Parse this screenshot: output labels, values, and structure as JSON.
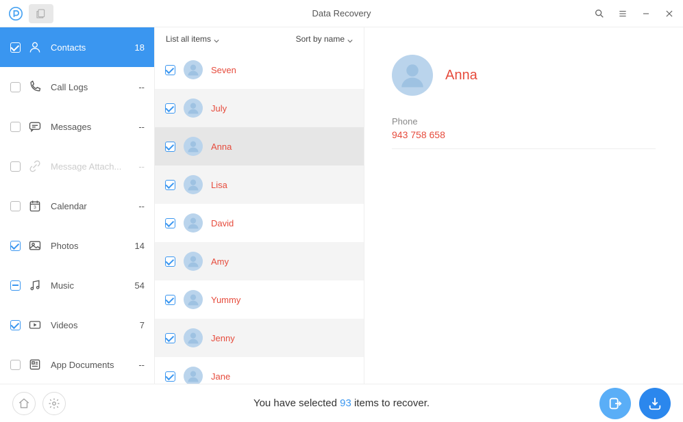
{
  "title": "Data Recovery",
  "dropdowns": {
    "list_mode": "List all items",
    "sort_mode": "Sort by name"
  },
  "sidebar": {
    "items": [
      {
        "id": "contacts",
        "label": "Contacts",
        "count": "18",
        "checked": true,
        "icon": "person-icon",
        "active": true,
        "disabled": false
      },
      {
        "id": "calllogs",
        "label": "Call Logs",
        "count": "--",
        "checked": false,
        "icon": "phone-icon",
        "active": false,
        "disabled": false
      },
      {
        "id": "messages",
        "label": "Messages",
        "count": "--",
        "checked": false,
        "icon": "message-icon",
        "active": false,
        "disabled": false
      },
      {
        "id": "msgatt",
        "label": "Message Attach...",
        "count": "--",
        "checked": false,
        "icon": "link-icon",
        "active": false,
        "disabled": true
      },
      {
        "id": "calendar",
        "label": "Calendar",
        "count": "--",
        "checked": false,
        "icon": "calendar-icon",
        "active": false,
        "disabled": false
      },
      {
        "id": "photos",
        "label": "Photos",
        "count": "14",
        "checked": true,
        "icon": "photo-icon",
        "active": false,
        "disabled": false
      },
      {
        "id": "music",
        "label": "Music",
        "count": "54",
        "checked": "minus",
        "icon": "music-icon",
        "active": false,
        "disabled": false
      },
      {
        "id": "videos",
        "label": "Videos",
        "count": "7",
        "checked": true,
        "icon": "video-icon",
        "active": false,
        "disabled": false
      },
      {
        "id": "appdocs",
        "label": "App Documents",
        "count": "--",
        "checked": false,
        "icon": "appdoc-icon",
        "active": false,
        "disabled": false
      }
    ]
  },
  "contacts": [
    {
      "name": "Seven",
      "checked": true,
      "alt": false,
      "selected": false
    },
    {
      "name": "July",
      "checked": true,
      "alt": true,
      "selected": false
    },
    {
      "name": "Anna",
      "checked": true,
      "alt": false,
      "selected": true
    },
    {
      "name": "Lisa",
      "checked": true,
      "alt": true,
      "selected": false
    },
    {
      "name": "David",
      "checked": true,
      "alt": false,
      "selected": false
    },
    {
      "name": "Amy",
      "checked": true,
      "alt": true,
      "selected": false
    },
    {
      "name": "Yummy",
      "checked": true,
      "alt": false,
      "selected": false
    },
    {
      "name": "Jenny",
      "checked": true,
      "alt": true,
      "selected": false
    },
    {
      "name": "Jane",
      "checked": true,
      "alt": false,
      "selected": false
    }
  ],
  "detail": {
    "name": "Anna",
    "phone_label": "Phone",
    "phone_value": "943 758 658"
  },
  "footer": {
    "text_before": "You have selected ",
    "count": "93",
    "text_after": " items to recover."
  }
}
